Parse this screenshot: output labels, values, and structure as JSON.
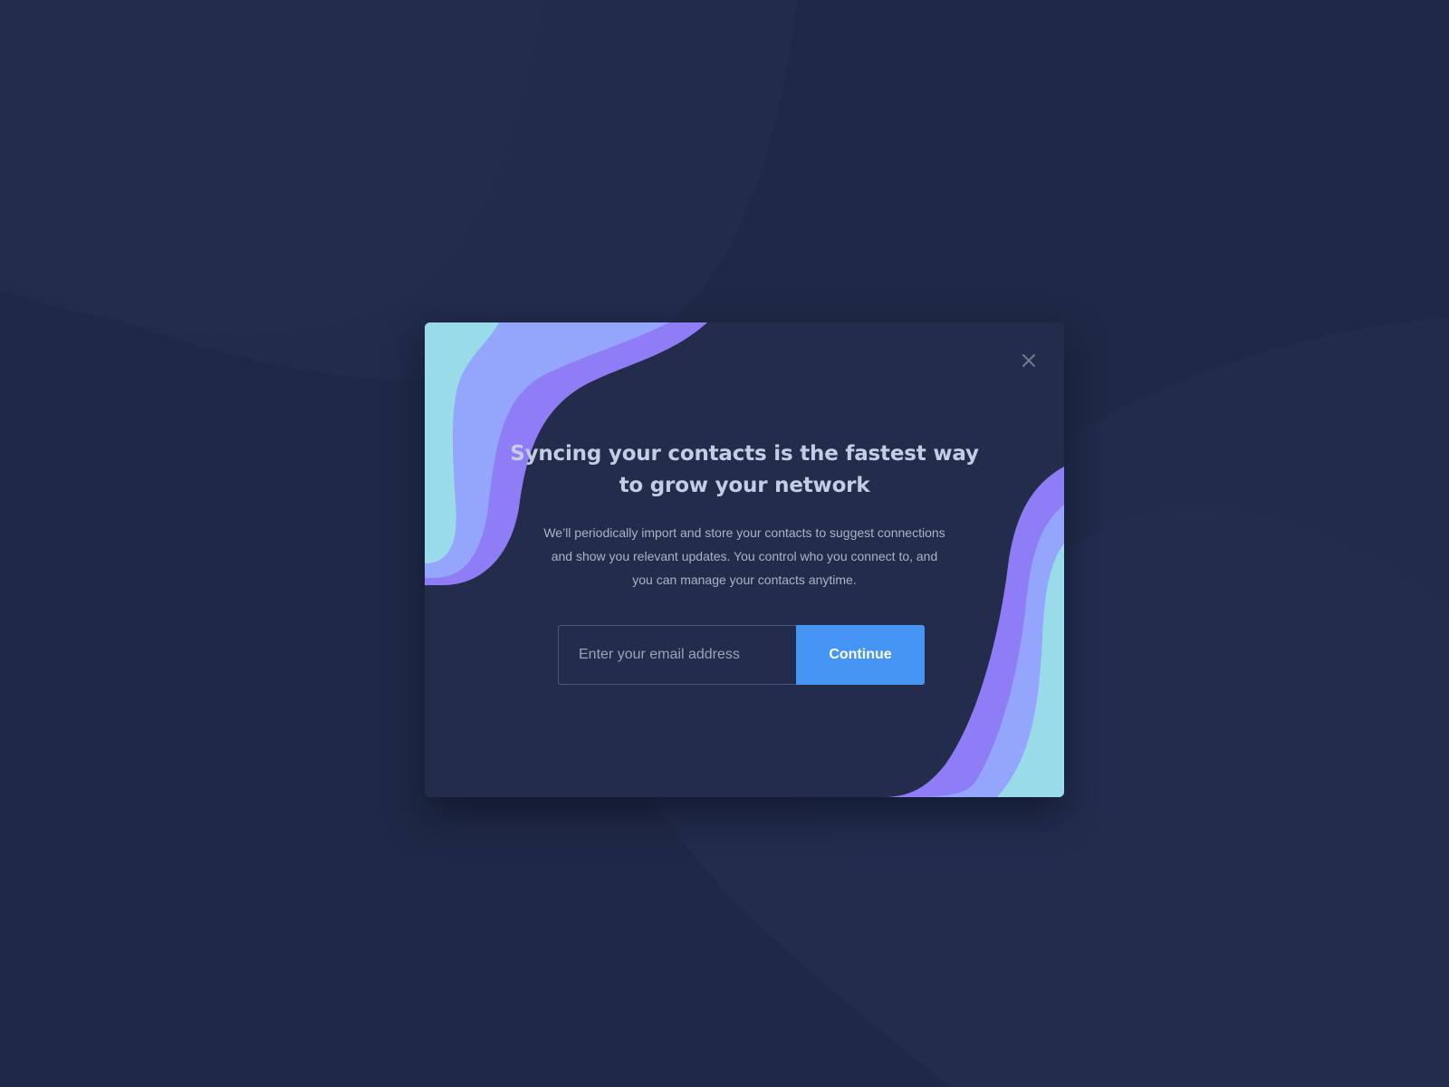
{
  "colors": {
    "background": "#1f2947",
    "modal": "#232d4b",
    "title": "#c3cde5",
    "body_text": "#a9b3ce",
    "button": "#4596f4",
    "wave_light": "#9adbe9",
    "wave_mid": "#93a6fb",
    "wave_dark": "#8f7cf7"
  },
  "modal": {
    "close_icon": "close-icon",
    "title": "Syncing your contacts is the fastest way to grow your network",
    "description": "We’ll periodically import and store your contacts to suggest connections and show you relevant updates. You control who you connect to, and you can manage your contacts anytime.",
    "email": {
      "placeholder": "Enter your email address",
      "value": ""
    },
    "continue_label": "Continue"
  }
}
